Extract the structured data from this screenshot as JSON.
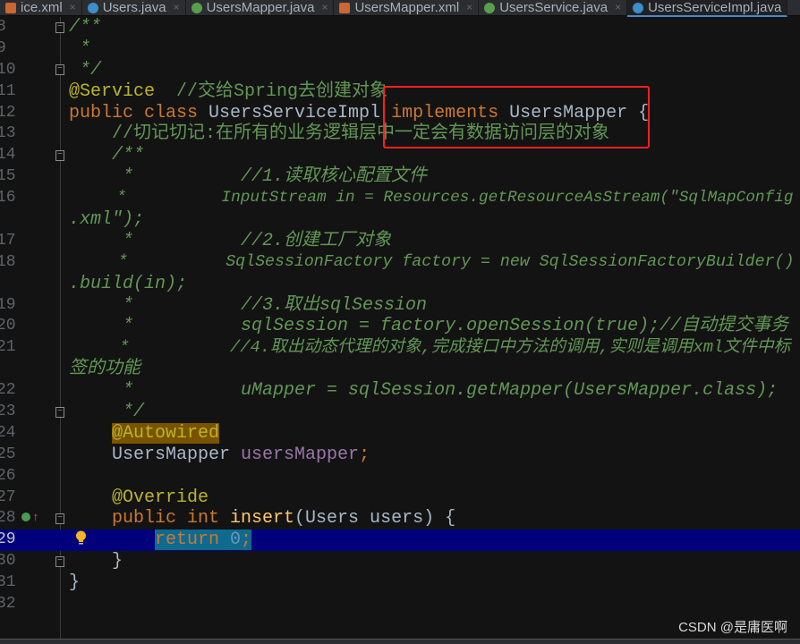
{
  "tabs": [
    {
      "label": "ice.xml",
      "icon": "xml-file-icon",
      "color": "#cc6633",
      "active": false
    },
    {
      "label": "Users.java",
      "icon": "class-icon",
      "color": "#3d8ec9",
      "active": false
    },
    {
      "label": "UsersMapper.java",
      "icon": "interface-icon",
      "color": "#5a9e4b",
      "active": false
    },
    {
      "label": "UsersMapper.xml",
      "icon": "xml-file-icon",
      "color": "#cc6633",
      "active": false
    },
    {
      "label": "UsersService.java",
      "icon": "interface-icon",
      "color": "#5a9e4b",
      "active": false
    },
    {
      "label": "UsersServiceImpl.java",
      "icon": "class-icon",
      "color": "#3d8ec9",
      "active": true
    }
  ],
  "lines": [
    {
      "n": "8",
      "t": [
        {
          "t": "/**",
          "c": "cm"
        }
      ]
    },
    {
      "n": "9",
      "t": [
        {
          "t": " *",
          "c": "cm"
        }
      ]
    },
    {
      "n": "10",
      "t": [
        {
          "t": " */",
          "c": "cm"
        }
      ]
    },
    {
      "n": "11",
      "t": [
        {
          "t": "@Service",
          "c": "an"
        },
        {
          "t": "  //交给Spring去创建对象",
          "c": "cmn"
        }
      ]
    },
    {
      "n": "12",
      "t": [
        {
          "t": "public class ",
          "c": "kw"
        },
        {
          "t": "UsersServiceImpl ",
          "c": ""
        },
        {
          "t": "implements ",
          "c": "kw"
        },
        {
          "t": "UsersMapper {",
          "c": ""
        }
      ]
    },
    {
      "n": "13",
      "t": [
        {
          "t": "    //切记切记:在所有的业务逻辑层中一定会有数据访问层的对象",
          "c": "cmn"
        }
      ]
    },
    {
      "n": "14",
      "t": [
        {
          "t": "    /**",
          "c": "cm"
        }
      ]
    },
    {
      "n": "15",
      "t": [
        {
          "t": "     *          //1.读取核心配置文件",
          "c": "cm"
        }
      ]
    },
    {
      "n": "16",
      "t": [
        {
          "t": "     *          InputStream in = Resources.getResourceAsStream(\"SqlMapConfig",
          "c": "cm"
        }
      ]
    },
    {
      "n": "",
      "t": [
        {
          "t": ".xml\");",
          "c": "cm"
        }
      ]
    },
    {
      "n": "17",
      "t": [
        {
          "t": "     *          //2.创建工厂对象",
          "c": "cm"
        }
      ]
    },
    {
      "n": "18",
      "t": [
        {
          "t": "     *          SqlSessionFactory factory = new SqlSessionFactoryBuilder()",
          "c": "cm"
        }
      ]
    },
    {
      "n": "",
      "t": [
        {
          "t": ".build(in);",
          "c": "cm"
        }
      ]
    },
    {
      "n": "19",
      "t": [
        {
          "t": "     *          //3.取出sqlSession",
          "c": "cm"
        }
      ]
    },
    {
      "n": "20",
      "t": [
        {
          "t": "     *          sqlSession = factory.openSession(true);//自动提交事务",
          "c": "cm"
        }
      ]
    },
    {
      "n": "21",
      "t": [
        {
          "t": "     *          //4.取出动态代理的对象,完成接口中方法的调用,实则是调用xml文件中标",
          "c": "cm"
        }
      ]
    },
    {
      "n": "",
      "t": [
        {
          "t": "签的功能",
          "c": "cm"
        }
      ]
    },
    {
      "n": "22",
      "t": [
        {
          "t": "     *          uMapper = sqlSession.getMapper(UsersMapper.class);",
          "c": "cm"
        }
      ]
    },
    {
      "n": "23",
      "t": [
        {
          "t": "     */",
          "c": "cm"
        }
      ]
    },
    {
      "n": "24",
      "t": [
        {
          "t": "    ",
          "c": ""
        },
        {
          "t": "@Autowired",
          "c": "an anbg"
        }
      ]
    },
    {
      "n": "25",
      "t": [
        {
          "t": "    UsersMapper ",
          "c": ""
        },
        {
          "t": "usersMapper",
          "c": "fd"
        },
        {
          "t": ";",
          "c": "kw"
        }
      ]
    },
    {
      "n": "26",
      "t": []
    },
    {
      "n": "27",
      "t": [
        {
          "t": "    @Override",
          "c": "an"
        }
      ]
    },
    {
      "n": "28",
      "t": [
        {
          "t": "    public int ",
          "c": "kw"
        },
        {
          "t": "insert",
          "c": "mt"
        },
        {
          "t": "(Users users) {",
          "c": ""
        }
      ]
    },
    {
      "n": "29",
      "hl": true,
      "t": [
        {
          "t": "        ",
          "c": ""
        },
        {
          "t": "return ",
          "c": "kw selbg"
        },
        {
          "t": "0",
          "c": "nm selbg"
        },
        {
          "t": ";",
          "c": "kw selbg"
        }
      ]
    },
    {
      "n": "30",
      "t": [
        {
          "t": "    }",
          "c": ""
        }
      ]
    },
    {
      "n": "31",
      "t": [
        {
          "t": "}",
          "c": ""
        }
      ]
    },
    {
      "n": "32",
      "t": []
    }
  ],
  "watermark": "CSDN @是庸医啊"
}
